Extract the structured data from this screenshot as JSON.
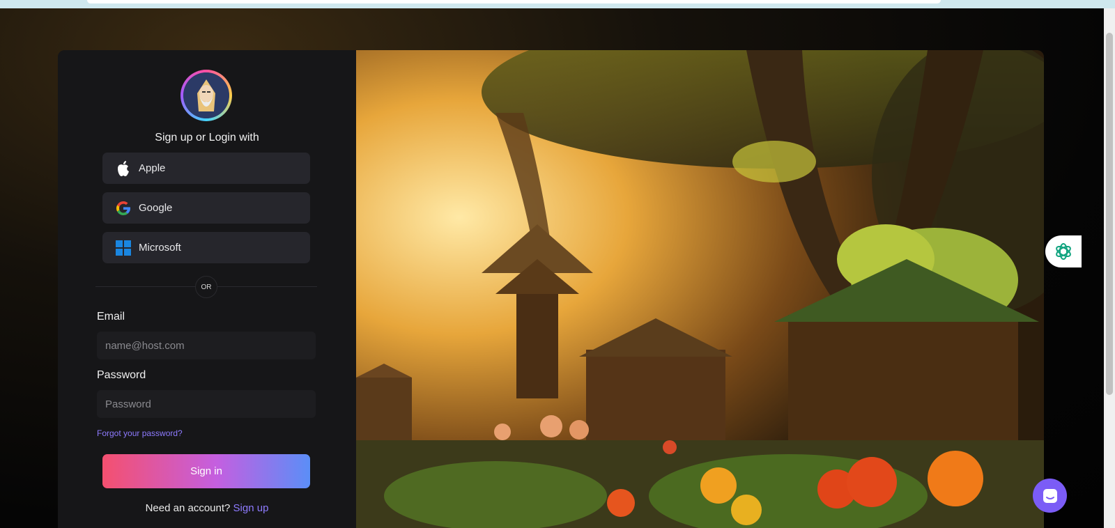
{
  "auth": {
    "heading": "Sign up or Login with",
    "providers": [
      {
        "label": "Apple",
        "icon": "apple-icon"
      },
      {
        "label": "Google",
        "icon": "google-icon"
      },
      {
        "label": "Microsoft",
        "icon": "microsoft-icon"
      }
    ],
    "divider_text": "OR",
    "email_label": "Email",
    "email_placeholder": "name@host.com",
    "password_label": "Password",
    "password_placeholder": "Password",
    "forgot_link": "Forgot your password?",
    "signin_button": "Sign in",
    "need_account_text": "Need an account?",
    "signup_link": "Sign up"
  },
  "colors": {
    "panel_bg": "#161618",
    "button_bg": "#26262c",
    "link": "#8e7bff",
    "gradient_start": "#f4506f",
    "gradient_end": "#5b8ef7",
    "chat_fab": "#7b5cf6",
    "assistant_icon": "#10a37f"
  },
  "widgets": {
    "side_tab_icon": "openai-icon",
    "chat_icon": "chat-icon"
  }
}
